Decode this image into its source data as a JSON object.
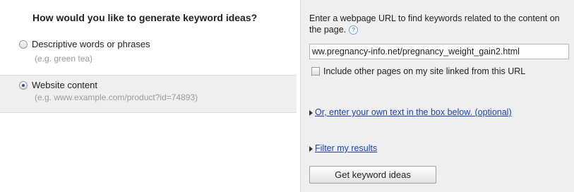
{
  "left": {
    "question": "How would you like to generate keyword ideas?",
    "options": [
      {
        "label": "Descriptive words or phrases",
        "hint": "(e.g. green tea)",
        "selected": false
      },
      {
        "label": "Website content",
        "hint": "(e.g. www.example.com/product?id=74893)",
        "selected": true
      }
    ]
  },
  "right": {
    "instruction": "Enter a webpage URL to find keywords related to the content on the page.",
    "help_icon": "help-icon",
    "url_value": "ww.pregnancy-info.net/pregnancy_weight_gain2.html",
    "checkbox_label": "Include other pages on my site linked from this URL",
    "checkbox_checked": false,
    "own_text_link": "Or, enter your own text in the box below. (optional)",
    "filter_link": "Filter my results",
    "submit_label": "Get keyword ideas"
  }
}
